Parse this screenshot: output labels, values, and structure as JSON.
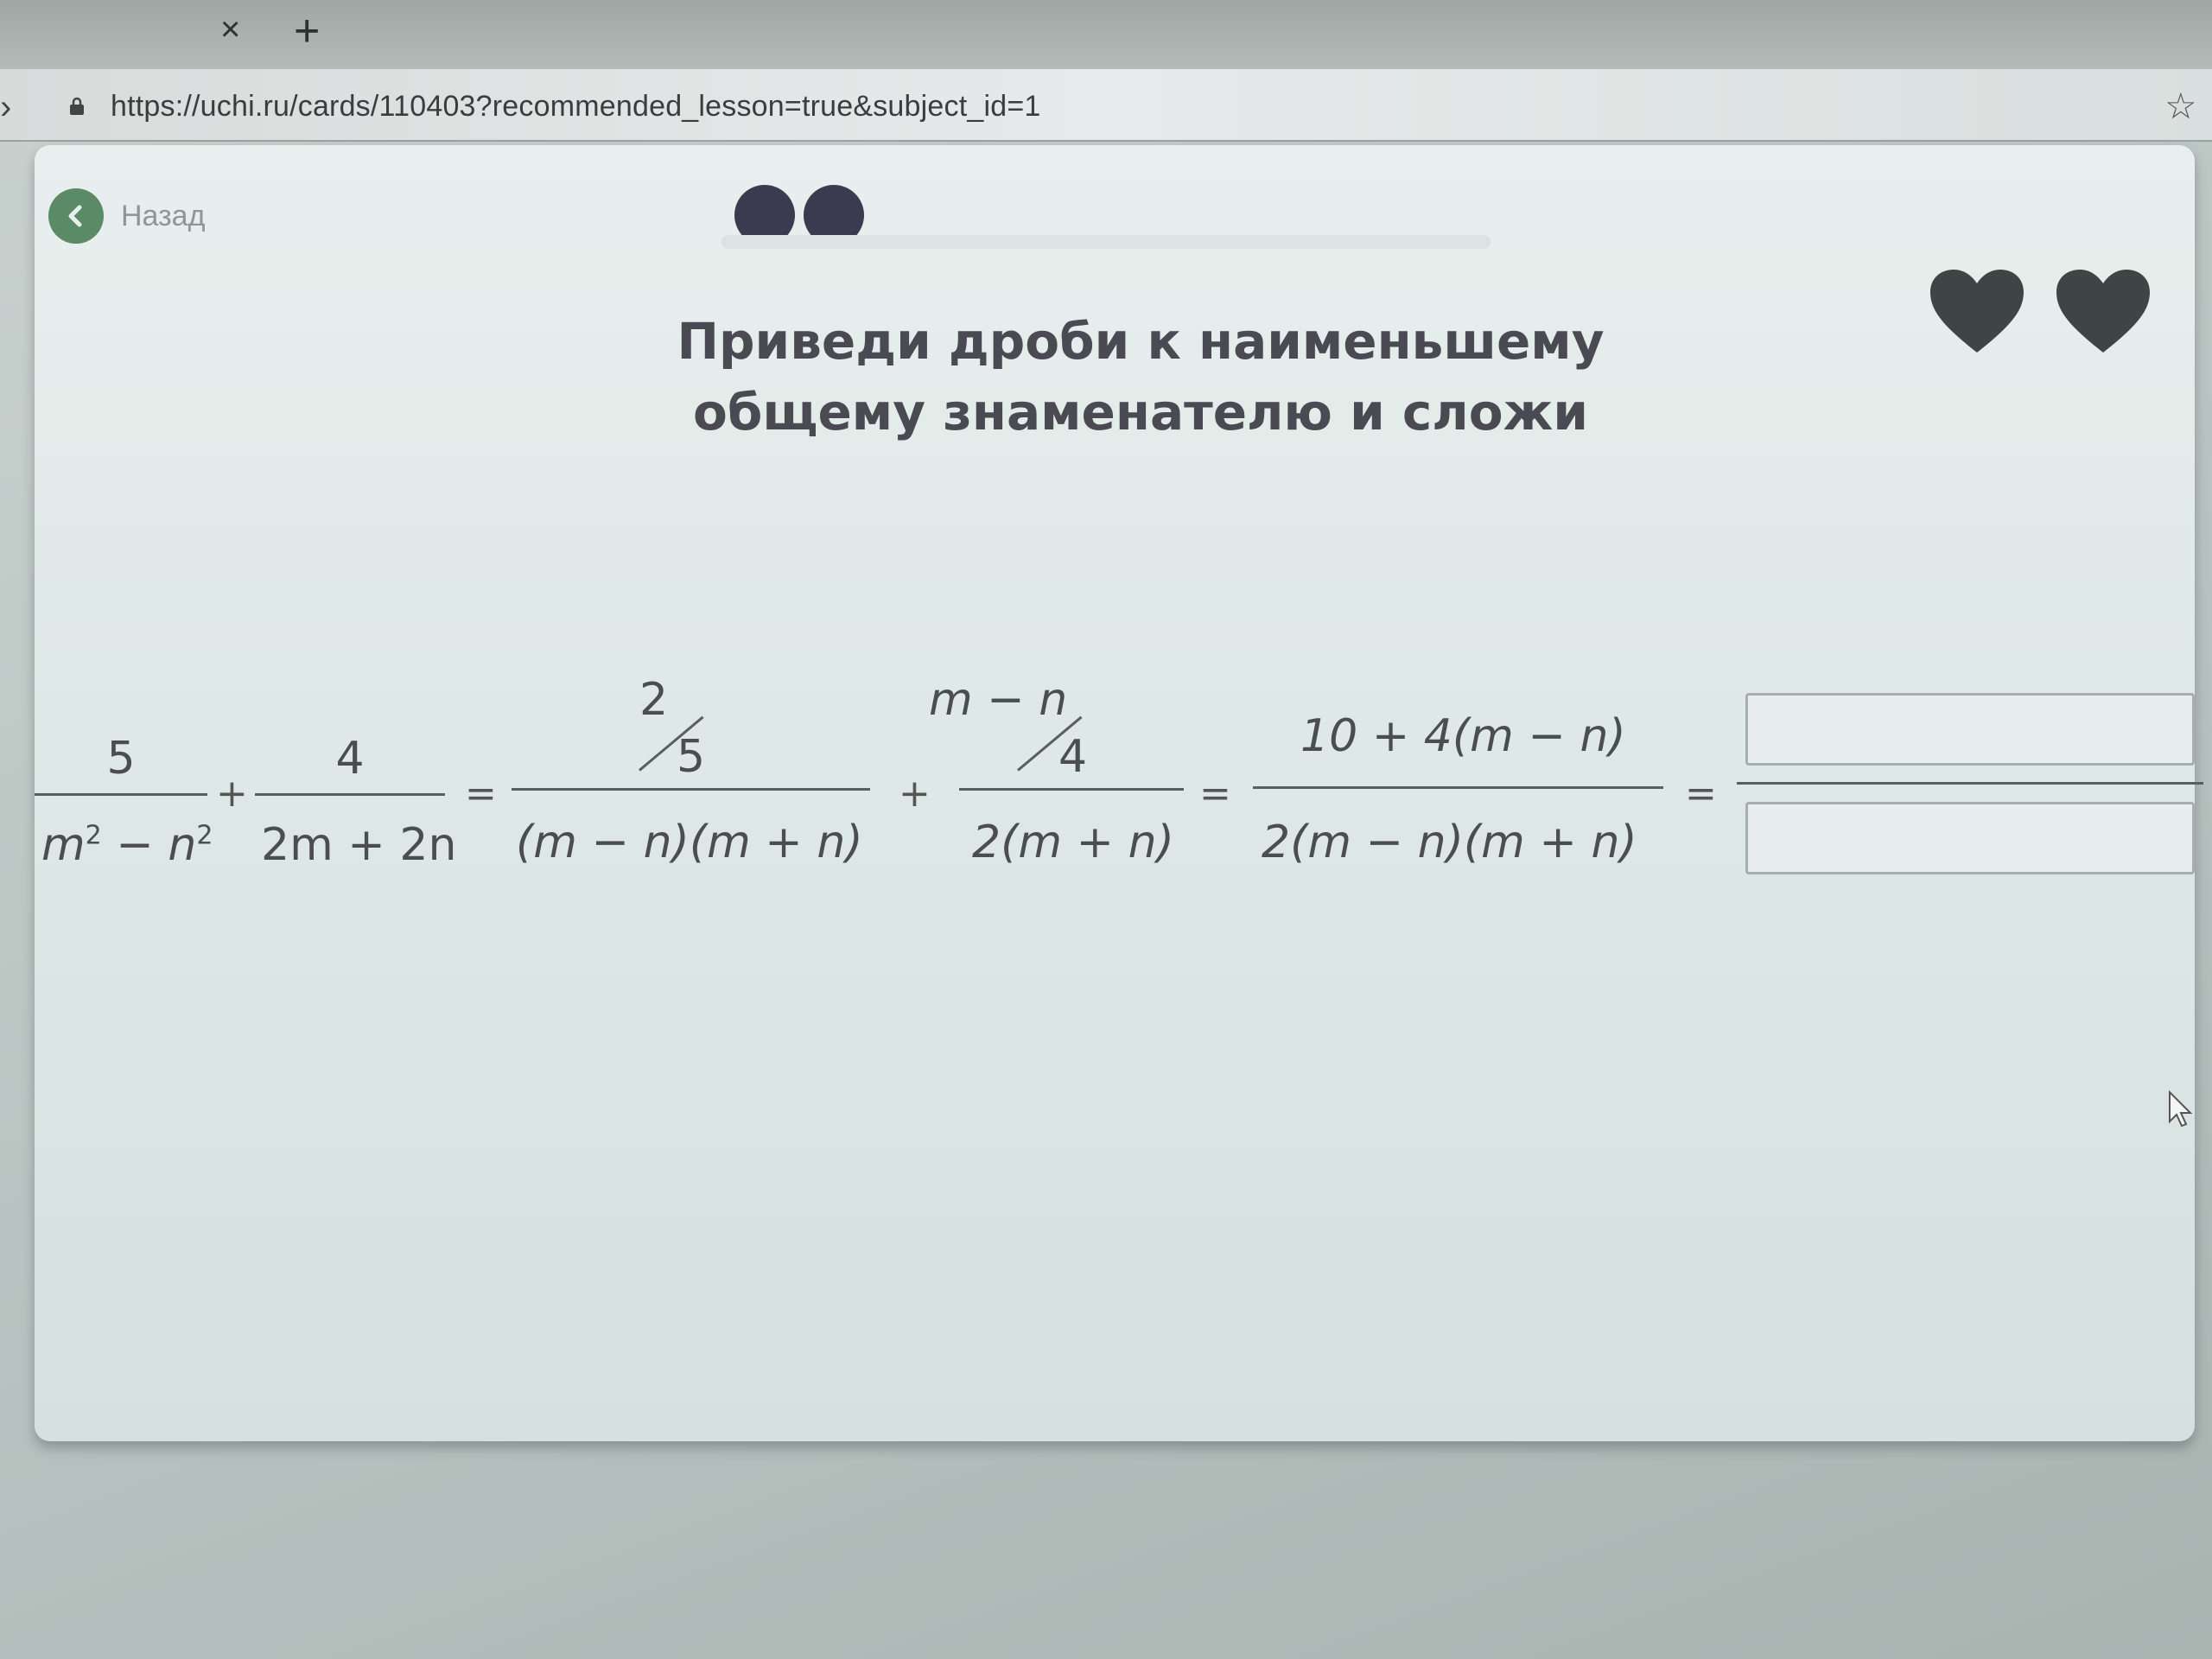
{
  "browser": {
    "tab_close": "×",
    "tab_new": "+",
    "url": "https://uchi.ru/cards/110403?recommended_lesson=true&subject_id=1",
    "star": "☆"
  },
  "nav": {
    "back_label": "Назад"
  },
  "progress": {
    "dots_filled": 2
  },
  "hearts": {
    "count": 2,
    "color": "#3d4545"
  },
  "title": {
    "line1": "Приведи дроби к наименьшему",
    "line2": "общему знаменателю и сложи"
  },
  "equation": {
    "f1_num": "5",
    "f1_den_m": "m",
    "f1_den_m_exp": "2",
    "f1_den_minus": " − ",
    "f1_den_n": "n",
    "f1_den_n_exp": "2",
    "plus1": "+",
    "f2_num": "4",
    "f2_den": "2m + 2n",
    "eq1": "=",
    "f3_factor_top": "2",
    "f3_factor_bottom": "5",
    "f3_den": "(m − n)(m + n)",
    "plus2": "+",
    "f4_factor_top": "m − n",
    "f4_factor_bottom": "4",
    "f4_den": "2(m + n)",
    "eq2": "=",
    "f5_num": "10 + 4(m − n)",
    "f5_den": "2(m − n)(m + n)",
    "eq3": "="
  },
  "answer": {
    "numerator_value": "",
    "denominator_value": ""
  },
  "colors": {
    "accent": "#5b8a66",
    "dots": "#3a3b4f"
  }
}
